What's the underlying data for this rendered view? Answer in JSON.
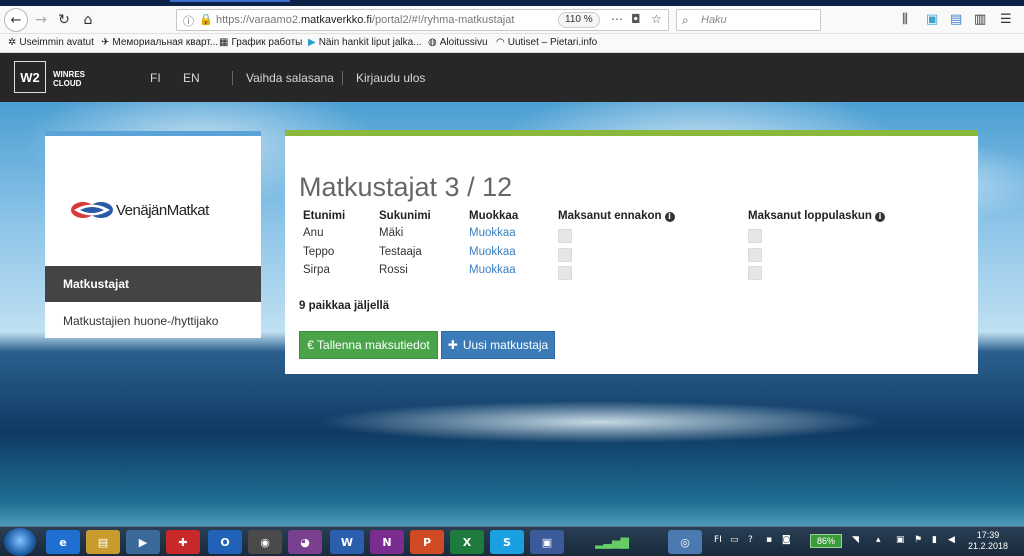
{
  "browser": {
    "url_prefix": "https://varaamo2.",
    "url_domain": "matkaverkko.fi",
    "url_path": "/portal2/#!/ryhma-matkustajat",
    "zoom": "110 %",
    "search_placeholder": "Haku",
    "bookmarks": [
      {
        "icon": "gear-icon",
        "label": "Useimmin avatut"
      },
      {
        "icon": "bookmark-icon",
        "label": "Мемориальная кварт..."
      },
      {
        "icon": "table-icon",
        "label": "График работы"
      },
      {
        "icon": "play-icon",
        "label": "Näin hankit liput jalka..."
      },
      {
        "icon": "globe-icon",
        "label": "Aloitussivu"
      },
      {
        "icon": "rss-icon",
        "label": "Uutiset – Pietari.info"
      }
    ]
  },
  "header": {
    "logo_mark": "W2",
    "logo_text_1": "WINRES",
    "logo_text_2": "CLOUD",
    "lang_fi": "FI",
    "lang_en": "EN",
    "change_password": "Vaihda salasana",
    "logout": "Kirjaudu ulos"
  },
  "sidebar": {
    "brand": "VenäjänMatkat",
    "items": [
      {
        "label": "Matkustajat",
        "active": true
      },
      {
        "label": "Matkustajien huone-/hyttijako",
        "active": false
      }
    ]
  },
  "main": {
    "title": "Matkustajat 3 / 12",
    "columns": [
      "Etunimi",
      "Sukunimi",
      "Muokkaa",
      "Maksanut ennakon",
      "Maksanut loppulaskun"
    ],
    "rows": [
      {
        "first": "Anu",
        "last": "Mäki",
        "edit": "Muokkaa"
      },
      {
        "first": "Teppo",
        "last": "Testaaja",
        "edit": "Muokkaa"
      },
      {
        "first": "Sirpa",
        "last": "Rossi",
        "edit": "Muokkaa"
      }
    ],
    "seats_left": "9 paikkaa jäljellä",
    "save_button": "€ Tallenna maksutiedot",
    "new_button": "Uusi matkustaja"
  },
  "taskbar": {
    "lang": "FI",
    "battery": "86%",
    "time": "17:39",
    "date": "21.2.2018"
  },
  "colors": {
    "header_bg": "#272727",
    "sidebar_accent": "#5aa3d8",
    "panel_accent": "#8ab83a",
    "save_green": "#4aa54a",
    "new_blue": "#3b7cb8",
    "link": "#3a7fbf"
  }
}
